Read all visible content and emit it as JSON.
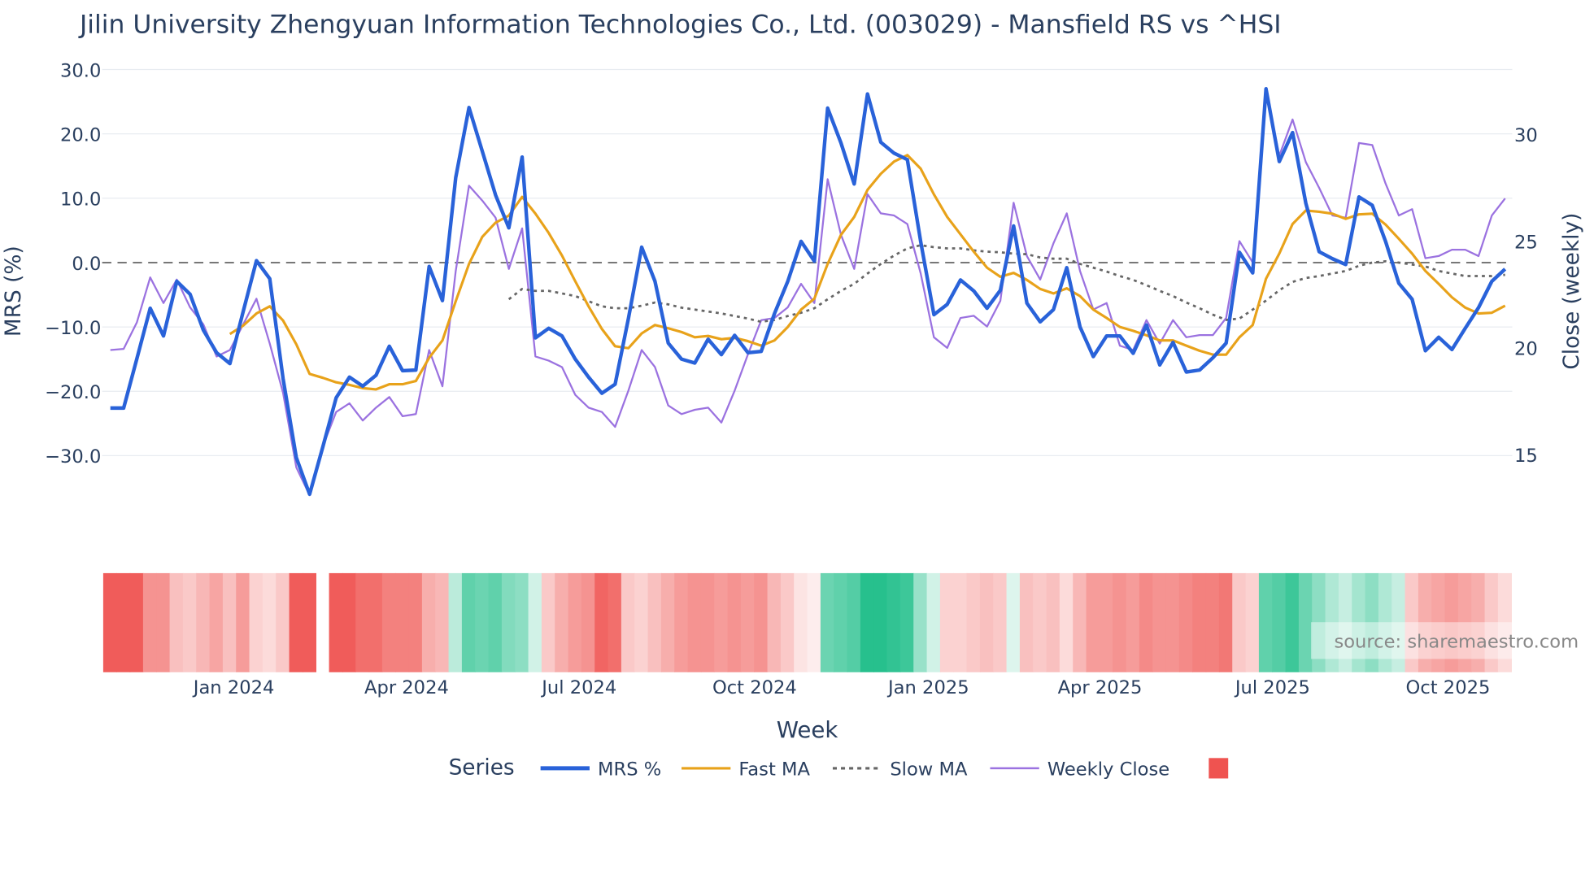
{
  "chart_data": {
    "type": "line",
    "title": "Jilin University Zhengyuan Information Technologies Co., Ltd. (003029) - Mansfield RS vs ^HSI",
    "xlabel": "Week",
    "ylabel_left": "MRS (%)",
    "ylabel_right": "Close (weekly)",
    "ylim_left": [
      -30,
      30
    ],
    "ylim_right": [
      15,
      30
    ],
    "yticks_left": [
      "30.0",
      "20.0",
      "10.0",
      "0.0",
      "−10.0",
      "−20.0",
      "−30.0"
    ],
    "yticks_left_values": [
      30,
      20,
      10,
      0,
      -10,
      -20,
      -30
    ],
    "yticks_right": [
      "30",
      "25",
      "20",
      "15"
    ],
    "yticks_right_values": [
      30,
      25,
      20,
      15
    ],
    "xticks": [
      {
        "label": "Jan 2024",
        "week": 9.3
      },
      {
        "label": "Apr 2024",
        "week": 22.3
      },
      {
        "label": "Jul 2024",
        "week": 35.3
      },
      {
        "label": "Oct 2024",
        "week": 48.5
      },
      {
        "label": "Jan 2025",
        "week": 61.6
      },
      {
        "label": "Apr 2025",
        "week": 74.5
      },
      {
        "label": "Jul 2025",
        "week": 87.5
      },
      {
        "label": "Oct 2025",
        "week": 100.7
      }
    ],
    "legend_title": "Series",
    "legend_placement": "bottom",
    "colors": {
      "mrs": "#2962d9",
      "fast": "#e8a21a",
      "slow": "#666666",
      "close": "#9b72e0",
      "zero": "#777777",
      "heat_neg": "#ef5350",
      "heat_pos": "#26c08d"
    },
    "watermark": "source: sharemaestro.com",
    "series": [
      {
        "name": "MRS %",
        "key": "mrs",
        "axis": "left",
        "values": [
          -22.6,
          -22.6,
          -14.9,
          -7.1,
          -11.4,
          -2.9,
          -4.9,
          -10.5,
          -14.0,
          -15.7,
          -7.6,
          0.3,
          -2.5,
          -18.0,
          -30.3,
          -36.0,
          -28.6,
          -21.0,
          -17.8,
          -19.2,
          -17.5,
          -13.0,
          -16.8,
          -16.7,
          -0.6,
          -5.9,
          13.2,
          24.1,
          17.3,
          10.5,
          5.4,
          16.4,
          -11.7,
          -10.2,
          -11.4,
          -15.0,
          -17.8,
          -20.3,
          -18.9,
          -8.7,
          2.4,
          -2.9,
          -12.5,
          -15.0,
          -15.6,
          -11.9,
          -14.3,
          -11.3,
          -14.0,
          -13.8,
          -7.9,
          -2.9,
          3.3,
          0.2,
          24.0,
          18.6,
          12.2,
          26.2,
          18.7,
          17.0,
          16.0,
          3.3,
          -8.1,
          -6.5,
          -2.7,
          -4.4,
          -7.1,
          -4.3,
          5.7,
          -6.3,
          -9.2,
          -7.3,
          -0.8,
          -10.0,
          -14.6,
          -11.4,
          -11.4,
          -14.1,
          -9.7,
          -15.9,
          -12.4,
          -17.0,
          -16.7,
          -14.8,
          -12.5,
          1.6,
          -1.6,
          27.0,
          15.7,
          20.2,
          9.2,
          1.7,
          0.6,
          -0.3,
          10.2,
          8.9,
          3.3,
          -3.2,
          -5.7,
          -13.7,
          -11.6,
          -13.5,
          -10.2,
          -7.0,
          -2.9,
          -1.0
        ]
      },
      {
        "name": "Fast MA",
        "key": "fast",
        "axis": "left",
        "values": [
          -11.1,
          -9.8,
          -7.9,
          -6.8,
          -9.0,
          -12.7,
          -17.3,
          -17.9,
          -18.6,
          -19.0,
          -19.5,
          -19.7,
          -18.9,
          -18.9,
          -18.4,
          -14.8,
          -12.1,
          -6.0,
          -0.2,
          4.0,
          6.2,
          7.3,
          10.2,
          7.6,
          4.6,
          1.1,
          -2.9,
          -6.8,
          -10.3,
          -13.0,
          -13.3,
          -11.0,
          -9.7,
          -10.2,
          -10.8,
          -11.6,
          -11.4,
          -11.9,
          -11.7,
          -12.2,
          -12.9,
          -12.1,
          -10.0,
          -7.3,
          -5.6,
          -0.2,
          4.3,
          7.1,
          11.3,
          13.8,
          15.7,
          16.7,
          14.6,
          10.6,
          7.1,
          4.4,
          1.7,
          -0.8,
          -2.2,
          -1.6,
          -2.7,
          -4.1,
          -4.8,
          -4.0,
          -5.2,
          -7.3,
          -8.6,
          -10.0,
          -10.6,
          -11.3,
          -12.1,
          -12.1,
          -12.9,
          -13.7,
          -14.3,
          -14.3,
          -11.6,
          -9.7,
          -2.5,
          1.4,
          6.0,
          8.1,
          7.9,
          7.6,
          6.8,
          7.5,
          7.6,
          5.9,
          3.7,
          1.4,
          -1.3,
          -3.3,
          -5.4,
          -7.0,
          -7.9,
          -7.8,
          -6.7
        ]
      },
      {
        "name": "Slow MA",
        "key": "slow",
        "axis": "left",
        "values": [
          -5.7,
          -4.1,
          -4.4,
          -4.4,
          -4.8,
          -5.2,
          -6.0,
          -6.8,
          -7.1,
          -7.1,
          -6.7,
          -6.2,
          -6.5,
          -7.0,
          -7.3,
          -7.6,
          -7.9,
          -8.3,
          -8.7,
          -9.2,
          -8.9,
          -8.3,
          -7.8,
          -7.1,
          -5.7,
          -4.4,
          -3.3,
          -1.7,
          -0.2,
          1.1,
          2.2,
          2.7,
          2.4,
          2.2,
          2.2,
          1.9,
          1.7,
          1.6,
          1.4,
          1.3,
          0.8,
          0.6,
          0.6,
          -0.2,
          -0.8,
          -1.4,
          -2.1,
          -2.7,
          -3.5,
          -4.4,
          -5.2,
          -6.2,
          -7.1,
          -8.1,
          -8.9,
          -8.7,
          -7.3,
          -5.9,
          -4.3,
          -3.0,
          -2.4,
          -2.1,
          -1.7,
          -1.3,
          -0.5,
          0.0,
          0.2,
          0.0,
          -0.3,
          -0.6,
          -1.3,
          -1.7,
          -2.1,
          -2.1,
          -2.1,
          -1.9
        ]
      },
      {
        "name": "Weekly Close",
        "key": "close",
        "axis": "right",
        "values": [
          19.9,
          19.95,
          21.2,
          23.3,
          22.1,
          23.2,
          21.9,
          21.1,
          19.6,
          19.9,
          21.1,
          22.3,
          20.2,
          17.9,
          14.4,
          13.1,
          15.4,
          17.0,
          17.4,
          16.6,
          17.2,
          17.7,
          16.8,
          16.9,
          19.9,
          18.2,
          23.6,
          27.6,
          26.9,
          26.1,
          23.7,
          25.6,
          19.6,
          19.4,
          19.1,
          17.8,
          17.2,
          17.0,
          16.3,
          18.0,
          19.9,
          19.1,
          17.3,
          16.9,
          17.1,
          17.2,
          16.5,
          18.0,
          19.7,
          21.3,
          21.4,
          21.9,
          23.0,
          22.1,
          27.9,
          25.3,
          23.7,
          27.2,
          26.3,
          26.2,
          25.8,
          23.5,
          20.5,
          20.0,
          21.4,
          21.5,
          21.0,
          22.2,
          26.8,
          24.3,
          23.2,
          24.9,
          26.3,
          23.6,
          21.8,
          22.1,
          20.1,
          19.9,
          21.3,
          20.2,
          21.3,
          20.5,
          20.6,
          20.6,
          21.4,
          25.0,
          24.0,
          32.1,
          29.0,
          30.7,
          28.7,
          27.5,
          26.2,
          26.1,
          29.6,
          29.5,
          27.7,
          26.2,
          26.5,
          24.2,
          24.3,
          24.6,
          24.6,
          24.3,
          26.2,
          27.0
        ]
      }
    ],
    "heatmap": [
      -0.9,
      -0.9,
      -0.9,
      -0.6,
      -0.6,
      -0.35,
      -0.3,
      -0.4,
      -0.5,
      -0.35,
      -0.55,
      -0.25,
      -0.2,
      -0.3,
      -0.9,
      -0.9,
      null,
      -0.9,
      -0.9,
      -0.8,
      -0.8,
      -0.7,
      -0.7,
      -0.7,
      -0.45,
      -0.4,
      0.3,
      0.7,
      0.65,
      0.7,
      0.55,
      0.5,
      0.2,
      -0.3,
      -0.45,
      -0.55,
      -0.6,
      -0.85,
      -0.8,
      -0.3,
      -0.25,
      -0.35,
      -0.45,
      -0.55,
      -0.6,
      -0.6,
      -0.55,
      -0.6,
      -0.55,
      -0.6,
      -0.4,
      -0.3,
      -0.15,
      -0.1,
      0.65,
      0.7,
      0.75,
      0.95,
      0.95,
      0.9,
      0.85,
      0.45,
      0.2,
      -0.25,
      -0.25,
      -0.3,
      -0.35,
      -0.3,
      0.15,
      -0.35,
      -0.3,
      -0.35,
      -0.2,
      -0.4,
      -0.55,
      -0.55,
      -0.6,
      -0.55,
      -0.65,
      -0.6,
      -0.6,
      -0.65,
      -0.7,
      -0.7,
      -0.75,
      -0.3,
      -0.25,
      0.7,
      0.75,
      0.85,
      0.65,
      0.5,
      0.35,
      0.25,
      0.4,
      0.5,
      0.35,
      0.25,
      -0.3,
      -0.45,
      -0.5,
      -0.55,
      -0.5,
      -0.45,
      -0.3,
      -0.2
    ]
  }
}
